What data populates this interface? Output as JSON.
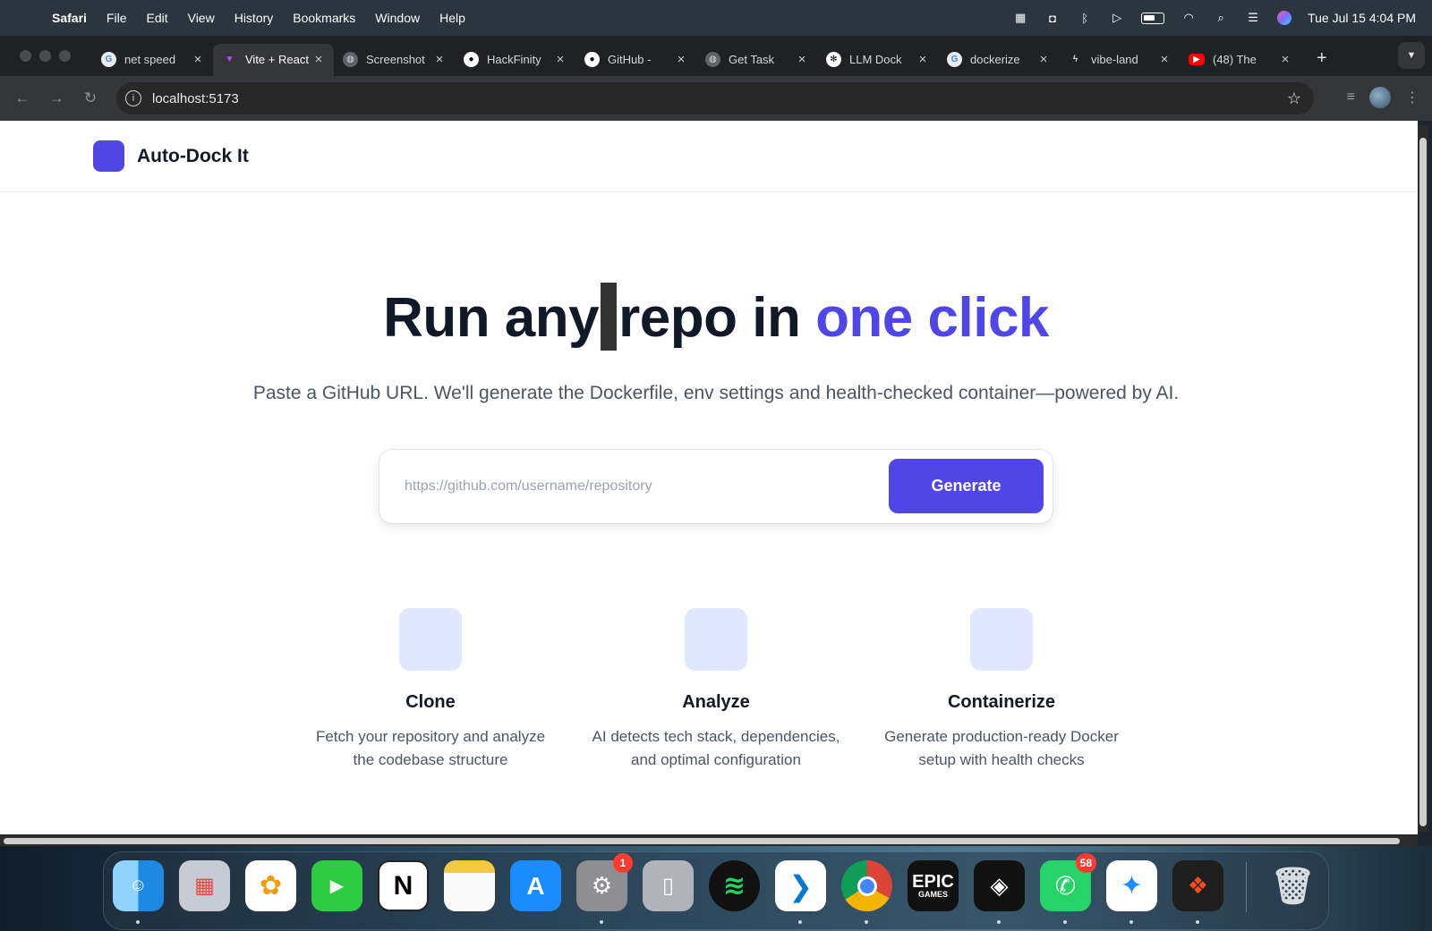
{
  "menubar": {
    "app_name": "Safari",
    "menus": [
      "File",
      "Edit",
      "View",
      "History",
      "Bookmarks",
      "Window",
      "Help"
    ],
    "clock": "Tue Jul 15  4:04 PM"
  },
  "tabs": [
    {
      "title": "net speed",
      "icon": "google-icon"
    },
    {
      "title": "Vite + React",
      "icon": "vite-icon"
    },
    {
      "title": "Screenshot",
      "icon": "globe-icon"
    },
    {
      "title": "HackFinity",
      "icon": "github-icon"
    },
    {
      "title": "GitHub - ",
      "icon": "github-icon"
    },
    {
      "title": "Get Task",
      "icon": "globe-icon"
    },
    {
      "title": "LLM Dock",
      "icon": "openai-icon"
    },
    {
      "title": "dockerize",
      "icon": "google-icon"
    },
    {
      "title": "vibe-land",
      "icon": "bolt-icon"
    },
    {
      "title": "(48) The",
      "icon": "youtube-icon"
    }
  ],
  "address": {
    "url": "localhost:5173"
  },
  "site": {
    "brand": "Auto-Dock It",
    "brand_color": "#4f46e5",
    "hero_title_part1": "Run any",
    "hero_title_part2": "repo in ",
    "hero_title_accent": "one click",
    "hero_subtitle": "Paste a GitHub URL. We'll generate the Dockerfile, env settings and health-checked container—powered by AI.",
    "input_placeholder": "https://github.com/username/repository",
    "generate_label": "Generate"
  },
  "features": [
    {
      "title": "Clone",
      "line1": "Fetch your repository and analyze",
      "line2": "the codebase structure"
    },
    {
      "title": "Analyze",
      "line1": "AI detects tech stack, dependencies,",
      "line2": "and optimal configuration"
    },
    {
      "title": "Containerize",
      "line1": "Generate production-ready Docker",
      "line2": "setup with health checks"
    }
  ],
  "dock": {
    "settings_badge": "1",
    "whatsapp_badge": "58",
    "epic_label_1": "EPIC",
    "epic_label_2": "GAMES",
    "notion_label": "N"
  }
}
